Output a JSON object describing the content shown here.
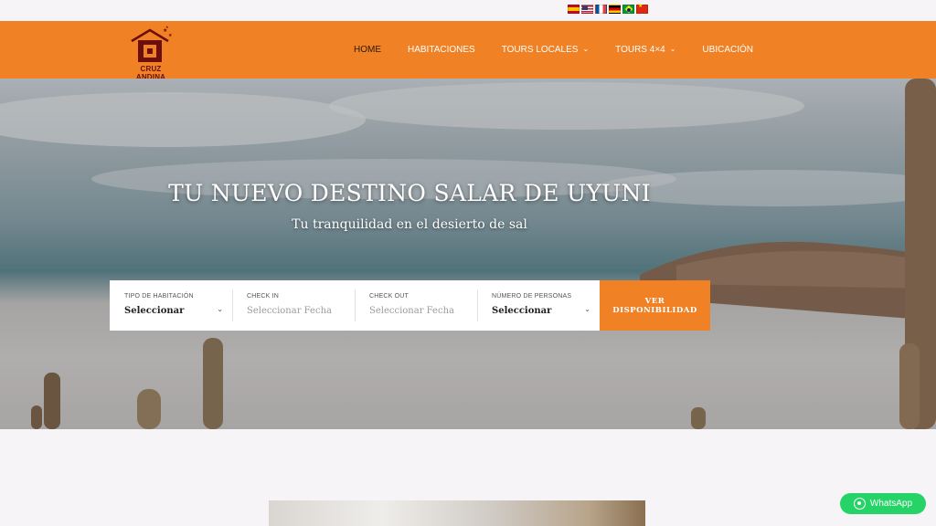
{
  "language_bar": {
    "flags": [
      "spain-flag-icon",
      "usa-flag-icon",
      "france-flag-icon",
      "germany-flag-icon",
      "brazil-flag-icon",
      "china-flag-icon"
    ]
  },
  "header": {
    "logo_text": "CRUZ ANDINA",
    "nav": [
      {
        "label": "HOME",
        "active": true
      },
      {
        "label": "HABITACIONES"
      },
      {
        "label": "TOURS LOCALES",
        "has_dropdown": true
      },
      {
        "label": "TOURS 4×4",
        "has_dropdown": true
      },
      {
        "label": "UBICACIÓN"
      }
    ],
    "background_color": "#f08124"
  },
  "hero": {
    "title": "TU NUEVO DESTINO SALAR DE UYUNI",
    "subtitle": "Tu tranquilidad en el desierto de sal"
  },
  "booking": {
    "room_type": {
      "label": "TIPO DE HABITACIÓN",
      "value": "Seleccionar"
    },
    "check_in": {
      "label": "CHECK IN",
      "placeholder": "Seleccionar Fecha"
    },
    "check_out": {
      "label": "CHECK OUT",
      "placeholder": "Seleccionar Fecha"
    },
    "guests": {
      "label": "NÚMERO DE PERSONAS",
      "value": "Seleccionar"
    },
    "button": "VER DISPONIBILIDAD"
  },
  "whatsapp": {
    "label": "WhatsApp",
    "color": "#25d366"
  }
}
